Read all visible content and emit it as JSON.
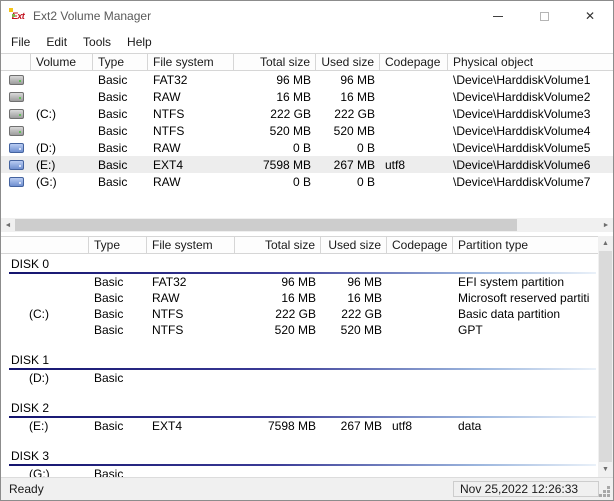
{
  "window": {
    "title": "Ext2 Volume Manager"
  },
  "app_icon_label": "Ext",
  "icons": {
    "close": "✕",
    "scroll_left": "◄",
    "scroll_right": "►",
    "scroll_up": "▲",
    "scroll_down": "▼"
  },
  "menu": {
    "items": [
      "File",
      "Edit",
      "Tools",
      "Help"
    ]
  },
  "volumes_panel": {
    "columns": [
      {
        "key": "icon",
        "label": ""
      },
      {
        "key": "volume",
        "label": "Volume"
      },
      {
        "key": "type",
        "label": "Type"
      },
      {
        "key": "file-system",
        "label": "File system"
      },
      {
        "key": "total-size",
        "label": "Total size"
      },
      {
        "key": "used-size",
        "label": "Used size"
      },
      {
        "key": "codepage",
        "label": "Codepage"
      },
      {
        "key": "physical-object",
        "label": "Physical object"
      }
    ],
    "rows": [
      {
        "icon": "gray-drive-icon",
        "volume": "",
        "type": "Basic",
        "file_system": "FAT32",
        "total_size": "96 MB",
        "used_size": "96 MB",
        "codepage": "",
        "physical_object": "\\Device\\HarddiskVolume1",
        "selected": false
      },
      {
        "icon": "gray-drive-icon",
        "volume": "",
        "type": "Basic",
        "file_system": "RAW",
        "total_size": "16 MB",
        "used_size": "16 MB",
        "codepage": "",
        "physical_object": "\\Device\\HarddiskVolume2",
        "selected": false
      },
      {
        "icon": "gray-drive-icon",
        "volume": "(C:)",
        "type": "Basic",
        "file_system": "NTFS",
        "total_size": "222 GB",
        "used_size": "222 GB",
        "codepage": "",
        "physical_object": "\\Device\\HarddiskVolume3",
        "selected": false
      },
      {
        "icon": "gray-drive-icon",
        "volume": "",
        "type": "Basic",
        "file_system": "NTFS",
        "total_size": "520 MB",
        "used_size": "520 MB",
        "codepage": "",
        "physical_object": "\\Device\\HarddiskVolume4",
        "selected": false
      },
      {
        "icon": "blue-drive-icon",
        "volume": "(D:)",
        "type": "Basic",
        "file_system": "RAW",
        "total_size": "0 B",
        "used_size": "0 B",
        "codepage": "",
        "physical_object": "\\Device\\HarddiskVolume5",
        "selected": false
      },
      {
        "icon": "blue-drive-icon",
        "volume": "(E:)",
        "type": "Basic",
        "file_system": "EXT4",
        "total_size": "7598 MB",
        "used_size": "267 MB",
        "codepage": "utf8",
        "physical_object": "\\Device\\HarddiskVolume6",
        "selected": true
      },
      {
        "icon": "blue-drive-icon",
        "volume": "(G:)",
        "type": "Basic",
        "file_system": "RAW",
        "total_size": "0 B",
        "used_size": "0 B",
        "codepage": "",
        "physical_object": "\\Device\\HarddiskVolume7",
        "selected": false
      }
    ]
  },
  "disks_panel": {
    "columns": [
      {
        "key": "volume",
        "label": ""
      },
      {
        "key": "type",
        "label": "Type"
      },
      {
        "key": "file-system",
        "label": "File system"
      },
      {
        "key": "total-size",
        "label": "Total size"
      },
      {
        "key": "used-size",
        "label": "Used size"
      },
      {
        "key": "codepage",
        "label": "Codepage"
      },
      {
        "key": "partition-type",
        "label": "Partition type"
      }
    ],
    "groups": [
      {
        "name": "DISK 0",
        "rows": [
          {
            "volume": "",
            "type": "Basic",
            "file_system": "FAT32",
            "total_size": "96 MB",
            "used_size": "96 MB",
            "codepage": "",
            "partition_type": "EFI system partition"
          },
          {
            "volume": "",
            "type": "Basic",
            "file_system": "RAW",
            "total_size": "16 MB",
            "used_size": "16 MB",
            "codepage": "",
            "partition_type": "Microsoft reserved partiti"
          },
          {
            "volume": "(C:)",
            "type": "Basic",
            "file_system": "NTFS",
            "total_size": "222 GB",
            "used_size": "222 GB",
            "codepage": "",
            "partition_type": "Basic data partition"
          },
          {
            "volume": "",
            "type": "Basic",
            "file_system": "NTFS",
            "total_size": "520 MB",
            "used_size": "520 MB",
            "codepage": "",
            "partition_type": "GPT"
          }
        ]
      },
      {
        "name": "DISK 1",
        "rows": [
          {
            "volume": "(D:)",
            "type": "Basic",
            "file_system": "",
            "total_size": "",
            "used_size": "",
            "codepage": "",
            "partition_type": ""
          }
        ]
      },
      {
        "name": "DISK 2",
        "rows": [
          {
            "volume": "(E:)",
            "type": "Basic",
            "file_system": "EXT4",
            "total_size": "7598 MB",
            "used_size": "267 MB",
            "codepage": "utf8",
            "partition_type": "data"
          }
        ]
      },
      {
        "name": "DISK 3",
        "rows": [
          {
            "volume": "(G:)",
            "type": "Basic",
            "file_system": "",
            "total_size": "",
            "used_size": "",
            "codepage": "",
            "partition_type": ""
          }
        ]
      }
    ]
  },
  "status_bar": {
    "status": "Ready",
    "datetime": "Nov 25,2022 12:26:33"
  }
}
